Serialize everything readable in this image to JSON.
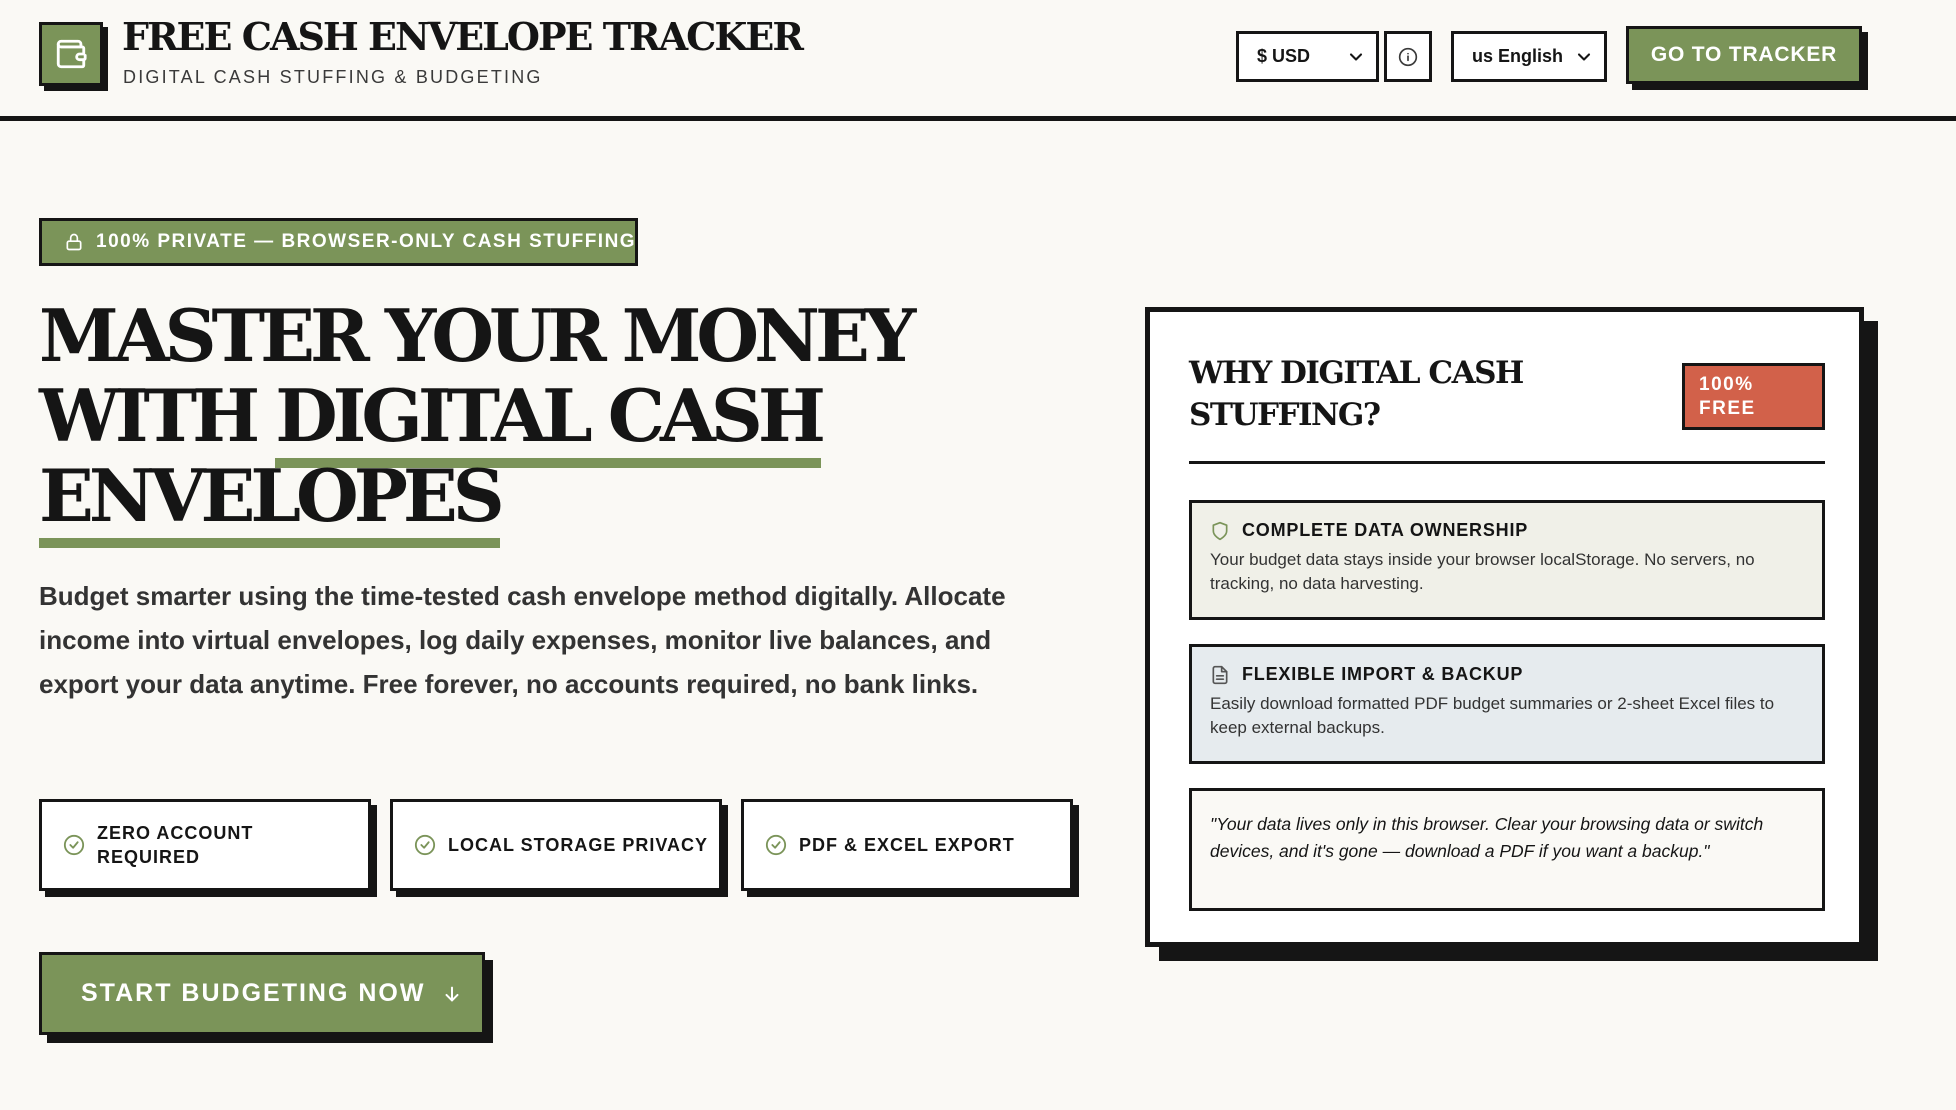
{
  "colors": {
    "accent": "#7b9459",
    "free_badge": "#d2614a",
    "ink": "#151515",
    "background": "#faf9f5",
    "card_ownership_bg": "#f0f0e8",
    "card_backup_bg": "#e6ebee"
  },
  "header": {
    "logo_icon": "wallet-icon",
    "title": "FREE CASH ENVELOPE TRACKER",
    "subtitle": "DIGITAL CASH STUFFING & BUDGETING",
    "currency_select": {
      "value": "$ USD",
      "icon": "chevron-down-icon"
    },
    "info_icon": "info-icon",
    "language_select": {
      "value": "us English",
      "icon": "chevron-down-icon"
    },
    "tracker_button": "GO TO TRACKER"
  },
  "hero": {
    "badge": {
      "icon": "lock-icon",
      "label": "100% PRIVATE — BROWSER-ONLY CASH STUFFING"
    },
    "title": {
      "line1": "MASTER YOUR MONEY",
      "line2_plain": "WITH ",
      "line2_highlight": "DIGITAL CASH",
      "line3_highlight": "ENVELOPES"
    },
    "description": "Budget smarter using the time-tested cash envelope method digitally. Allocate income into virtual envelopes, log daily expenses, monitor live balances, and export your data anytime. Free forever, no accounts required, no bank links.",
    "features": [
      {
        "icon": "check-circle-icon",
        "label": "ZERO ACCOUNT REQUIRED"
      },
      {
        "icon": "check-circle-icon",
        "label": "LOCAL STORAGE PRIVACY"
      },
      {
        "icon": "check-circle-icon",
        "label": "PDF & EXCEL EXPORT"
      }
    ],
    "cta": {
      "label": "START BUDGETING NOW",
      "icon": "arrow-down-icon"
    }
  },
  "why_panel": {
    "title": "WHY DIGITAL CASH STUFFING?",
    "badge": "100% FREE",
    "cards": [
      {
        "icon": "shield-icon",
        "title": "COMPLETE DATA OWNERSHIP",
        "body": "Your budget data stays inside your browser localStorage. No servers, no tracking, no data harvesting."
      },
      {
        "icon": "document-icon",
        "title": "FLEXIBLE IMPORT & BACKUP",
        "body": "Easily download formatted PDF budget summaries or 2-sheet Excel files to keep external backups."
      }
    ],
    "quote": "\"Your data lives only in this browser. Clear your browsing data or switch devices, and it's gone — download a PDF if you want a backup.\""
  }
}
